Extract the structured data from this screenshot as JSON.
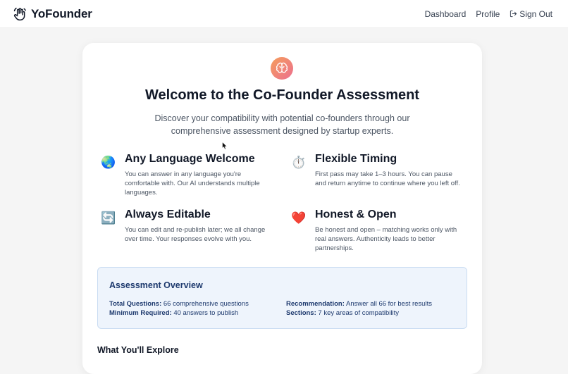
{
  "header": {
    "brand": "YoFounder",
    "nav": {
      "dashboard": "Dashboard",
      "profile": "Profile",
      "sign_out": "Sign Out"
    }
  },
  "main": {
    "title": "Welcome to the Co-Founder Assessment",
    "subtitle": "Discover your compatibility with potential co-founders through our comprehensive assessment designed by startup experts.",
    "features": [
      {
        "icon": "globe-icon",
        "glyph": "🌏",
        "title": "Any Language Welcome",
        "description": "You can answer in any language you're comfortable with. Our AI understands multiple languages."
      },
      {
        "icon": "stopwatch-icon",
        "glyph": "⏱️",
        "title": "Flexible Timing",
        "description": "First pass may take 1–3 hours. You can pause and return anytime to continue where you left off."
      },
      {
        "icon": "refresh-icon",
        "glyph": "🔄",
        "title": "Always Editable",
        "description": "You can edit and re-publish later; we all change over time. Your responses evolve with you."
      },
      {
        "icon": "heart-icon",
        "glyph": "❤️",
        "title": "Honest & Open",
        "description": "Be honest and open – matching works only with real answers. Authenticity leads to better partnerships."
      }
    ],
    "overview": {
      "title": "Assessment Overview",
      "total_questions_label": "Total Questions:",
      "total_questions_value": "66 comprehensive questions",
      "minimum_required_label": "Minimum Required:",
      "minimum_required_value": "40 answers to publish",
      "recommendation_label": "Recommendation:",
      "recommendation_value": "Answer all 66 for best results",
      "sections_label": "Sections:",
      "sections_value": "7 key areas of compatibility"
    },
    "explore_heading": "What You'll Explore"
  },
  "colors": {
    "accent_gradient_start": "#f59e5b",
    "accent_gradient_end": "#ec6f8f",
    "overview_bg": "#eef4fc",
    "overview_border": "#c9dcf2",
    "overview_text": "#1e3a6e"
  }
}
